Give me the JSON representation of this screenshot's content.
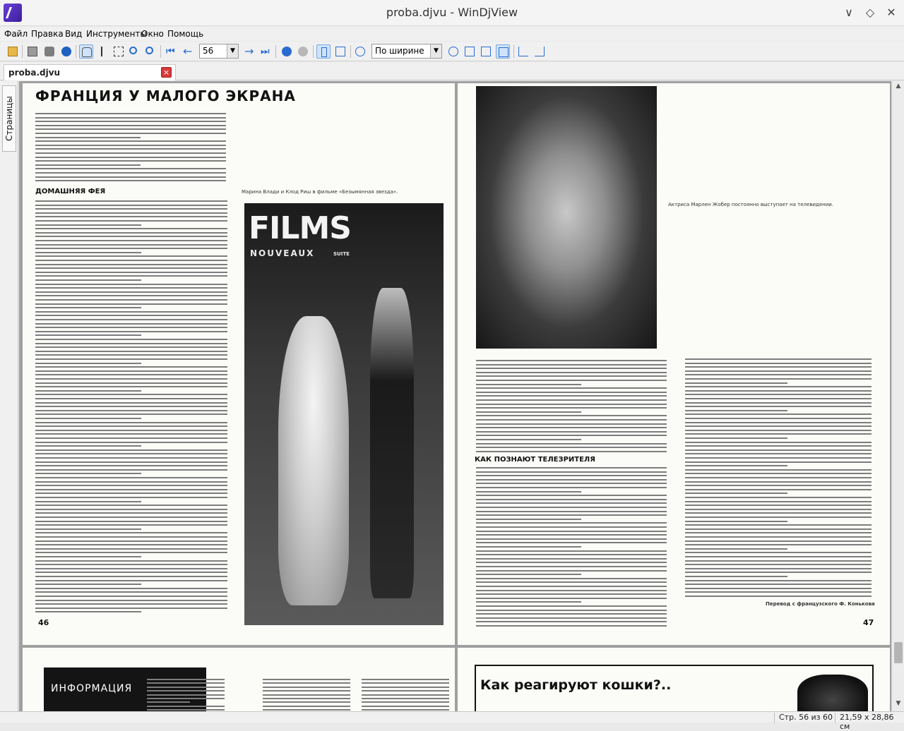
{
  "window": {
    "title": "proba.djvu - WinDjView"
  },
  "menu": [
    "Файл",
    "Правка",
    "Вид",
    "Инструменты",
    "Окно",
    "Помощь"
  ],
  "toolbar": {
    "page_number": "56",
    "zoom": "По ширине",
    "icons": [
      "open-icon",
      "print-icon",
      "find-icon",
      "info-icon",
      "hand-tool-icon",
      "text-select-icon",
      "rect-select-icon",
      "zoom-icon",
      "magnify-icon",
      "first-page-icon",
      "prev-page-icon",
      "next-page-icon",
      "last-page-icon",
      "back-icon",
      "forward-icon",
      "single-page-icon",
      "facing-pages-icon",
      "zoom-out-icon",
      "zoom-in-icon",
      "fit-width-icon",
      "fit-page-icon",
      "actual-size-icon",
      "rotate-left-icon",
      "rotate-right-icon"
    ]
  },
  "tab": {
    "label": "proba.djvu",
    "close": "×"
  },
  "sidebar": {
    "tab_label": "Страницы"
  },
  "document": {
    "left_page": {
      "title": "ФРАНЦИЯ У МАЛОГО ЭКРАНА",
      "section_1": "ДОМАШНЯЯ ФЕЯ",
      "caption": "Марина Влади и Клод Риш в фильме «Безымянная звезда».",
      "photo_logo_1": "FILMS",
      "photo_logo_2": "NOUVEAUX",
      "photo_logo_3": "SUITE",
      "page_number": "46"
    },
    "right_page": {
      "section_1": "КАК ПОЗНАЮТ ТЕЛЕЗРИТЕЛЯ",
      "caption": "Актриса Марлен Жобер постоянно выступает на телевидении.",
      "credit": "Перевод с французского Ф. Конькова",
      "page_number": "47"
    },
    "bottom_left": {
      "heading": "ИНФОРМАЦИЯ"
    },
    "bottom_right": {
      "heading": "Как реагируют кошки?.."
    }
  },
  "status": {
    "page": "Стр. 56 из 60",
    "size": "21,59 x 28,86 см"
  }
}
